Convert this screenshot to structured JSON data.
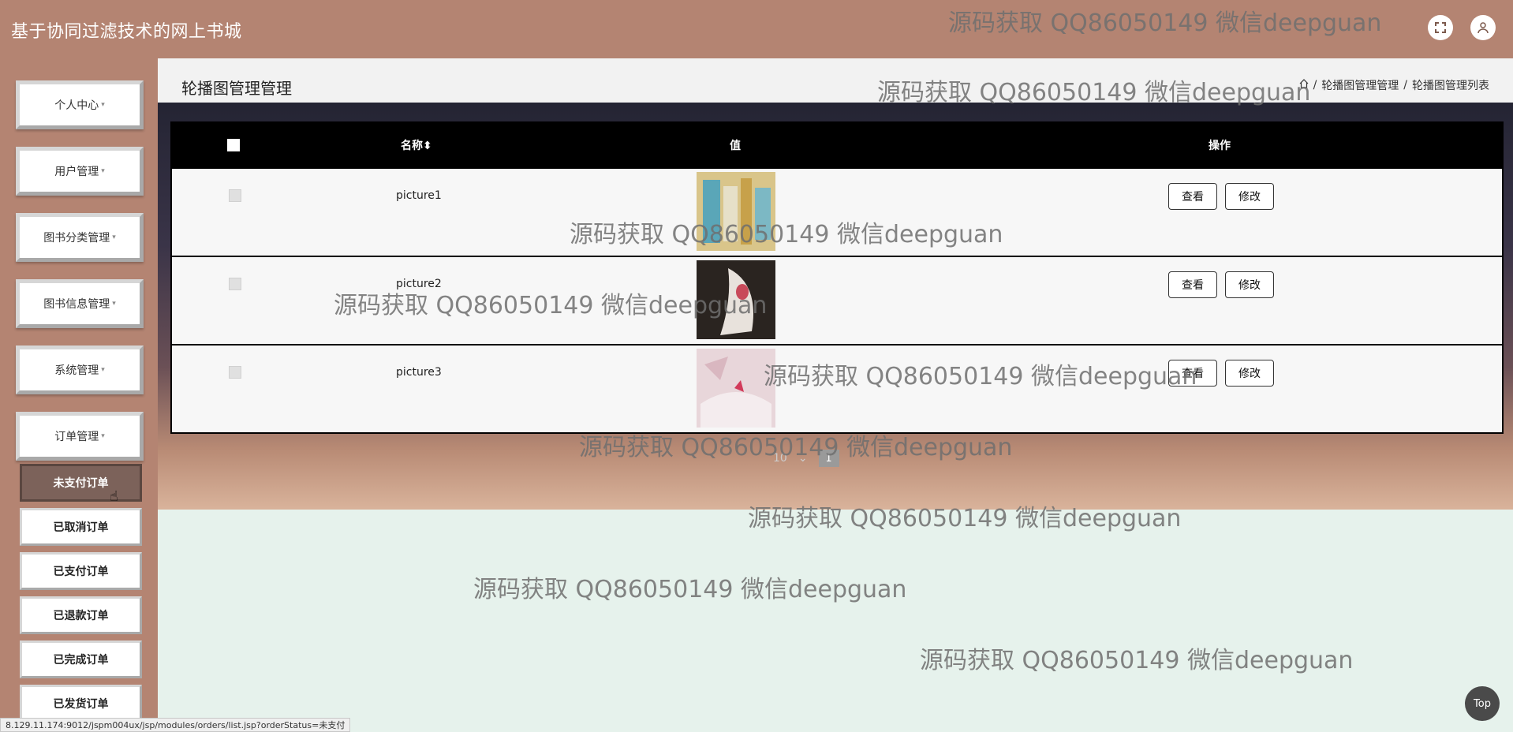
{
  "app": {
    "title": "基于协同过滤技术的网上书城"
  },
  "header": {
    "expand_icon": "expand-icon",
    "user_icon": "user-icon"
  },
  "sidebar": {
    "items": [
      {
        "label": "个人中心",
        "caret": "▾"
      },
      {
        "label": "用户管理",
        "caret": "▾"
      },
      {
        "label": "图书分类管理",
        "caret": "▾"
      },
      {
        "label": "图书信息管理",
        "caret": "▾"
      },
      {
        "label": "系统管理",
        "caret": "▾"
      },
      {
        "label": "订单管理",
        "caret": "▾"
      }
    ],
    "sub_items": [
      {
        "label": "未支付订单",
        "active": true
      },
      {
        "label": "已取消订单"
      },
      {
        "label": "已支付订单"
      },
      {
        "label": "已退款订单"
      },
      {
        "label": "已完成订单"
      },
      {
        "label": "已发货订单"
      }
    ]
  },
  "page": {
    "title": "轮播图管理管理",
    "breadcrumb": {
      "home_icon": "home-icon",
      "sep1": "/",
      "level1": "轮播图管理管理",
      "sep2": "/",
      "level2": "轮播图管理列表"
    }
  },
  "table": {
    "headers": {
      "name": "名称",
      "sort_icon": "⬍",
      "value": "值",
      "actions": "操作"
    },
    "rows": [
      {
        "name": "picture1",
        "view": "查看",
        "edit": "修改"
      },
      {
        "name": "picture2",
        "view": "查看",
        "edit": "修改"
      },
      {
        "name": "picture3",
        "view": "查看",
        "edit": "修改"
      }
    ]
  },
  "pager": {
    "page_size": "10",
    "current_page": "1"
  },
  "watermark": "源码获取 QQ86050149 微信deepguan",
  "top_button": "Top",
  "status_url": "8.129.11.174:9012/jspm004ux/jsp/modules/orders/list.jsp?orderStatus=未支付",
  "colors": {
    "header": "#b48472",
    "active_sub": "#7c625a",
    "table_header": "#000000",
    "content_bg": "#e6f2ec"
  }
}
